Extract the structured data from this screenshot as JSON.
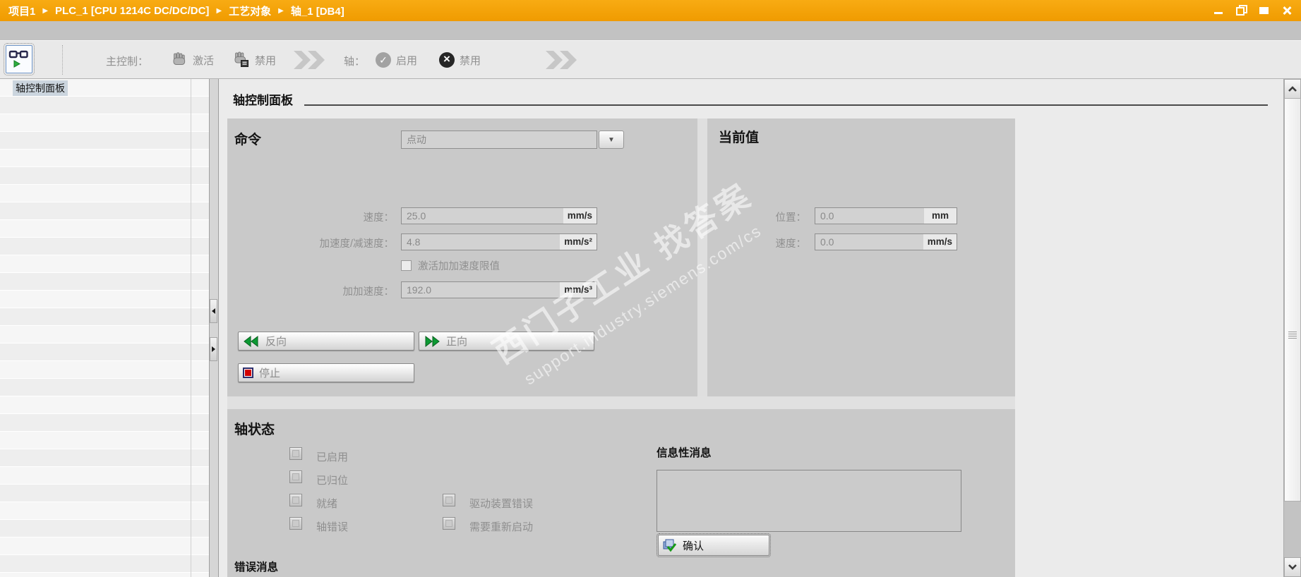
{
  "title_bar": {
    "breadcrumb": [
      "项目1",
      "PLC_1 [CPU 1214C DC/DC/DC]",
      "工艺对象",
      "轴_1 [DB4]"
    ]
  },
  "icons": {
    "crumb_separator": "▶",
    "dropdown_arrow": "▼",
    "enable_check": "✓",
    "disable_cross": "×"
  },
  "toolbar": {
    "master_control_label": "主控制：",
    "activate_label": "激活",
    "deactivate_label": "禁用",
    "axis_label": "轴：",
    "enable_label": "启用",
    "disable_label": "禁用"
  },
  "sidebar": {
    "selected_item": "轴控制面板"
  },
  "main": {
    "heading": "轴控制面板",
    "command": {
      "heading": "命令",
      "mode_value": "点动",
      "fields": [
        {
          "label": "速度：",
          "value": "25.0",
          "unit": "mm/s"
        },
        {
          "label": "加速度/减速度：",
          "value": "4.8",
          "unit": "mm/s²"
        },
        {
          "label": "加加速度：",
          "value": "192.0",
          "unit": "mm/s³"
        }
      ],
      "jerk_checkbox_label": "激活加加速度限值",
      "backward_label": "反向",
      "forward_label": "正向",
      "stop_label": "停止"
    },
    "current_values": {
      "heading": "当前值",
      "fields": [
        {
          "label": "位置：",
          "value": "0.0",
          "unit": "mm"
        },
        {
          "label": "速度：",
          "value": "0.0",
          "unit": "mm/s"
        }
      ]
    },
    "axis_status": {
      "heading": "轴状态",
      "col1": [
        "已启用",
        "已归位",
        "就绪",
        "轴错误"
      ],
      "col2": [
        "驱动装置错误",
        "需要重新启动"
      ],
      "info_label": "信息性消息",
      "ack_label": "确认",
      "error_label": "错误消息"
    }
  },
  "watermark": {
    "line1": "西门子工业 找答案",
    "line2": "support.industry.siemens.com/cs"
  },
  "colors": {
    "titlebar_orange": "#f4a306",
    "panel_gray": "#c9c9c9",
    "stop_red": "#d20000",
    "arrow_green": "#0c9a33",
    "selection_blue_gray": "#cbd5de"
  }
}
